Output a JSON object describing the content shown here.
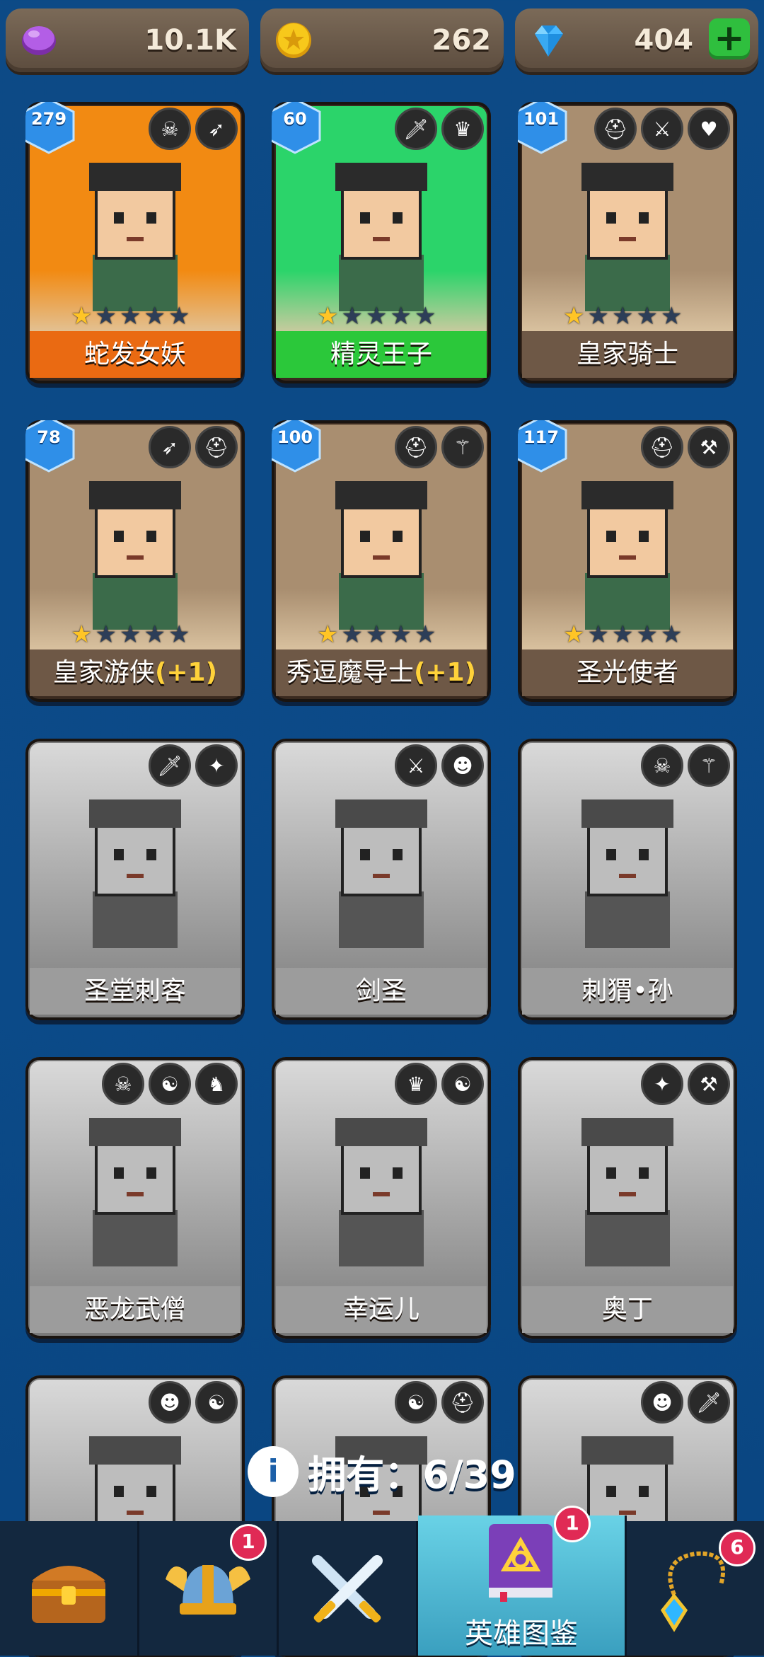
{
  "currencies": [
    {
      "name": "purple-gem",
      "value": "10.1K",
      "color": "#a34bd6"
    },
    {
      "name": "gold-coin",
      "value": "262",
      "color": "#f5c518"
    },
    {
      "name": "blue-diamond",
      "value": "404",
      "color": "#2fb7ff"
    }
  ],
  "heroes": [
    {
      "name": "蛇发女妖",
      "suffix": "",
      "level": "279",
      "stars": 1,
      "owned": true,
      "bg": "#f28a12",
      "bar": "#ea6a12",
      "badges": [
        "skull-icon",
        "bow-icon"
      ]
    },
    {
      "name": "精灵王子",
      "suffix": "",
      "level": "60",
      "stars": 1,
      "owned": true,
      "bg": "#2bd46a",
      "bar": "#2bc83a",
      "badges": [
        "dagger-icon",
        "elf-icon"
      ]
    },
    {
      "name": "皇家骑士",
      "suffix": "",
      "level": "101",
      "stars": 1,
      "owned": true,
      "bg": "#a98e70",
      "bar": "#6e5846",
      "badges": [
        "helmet-icon",
        "sword-icon",
        "heart-icon"
      ]
    },
    {
      "name": "皇家游侠",
      "suffix": "(+1)",
      "level": "78",
      "stars": 1,
      "owned": true,
      "bg": "#a98e70",
      "bar": "#6e5846",
      "badges": [
        "bow-icon",
        "helmet-icon"
      ]
    },
    {
      "name": "秀逗魔导士",
      "suffix": "(+1)",
      "level": "100",
      "stars": 1,
      "owned": true,
      "bg": "#a98e70",
      "bar": "#6e5846",
      "badges": [
        "helmet-icon",
        "staff-icon"
      ]
    },
    {
      "name": "圣光使者",
      "suffix": "",
      "level": "117",
      "stars": 1,
      "owned": true,
      "bg": "#a98e70",
      "bar": "#6e5846",
      "badges": [
        "helmet-icon",
        "hammer-icon"
      ]
    },
    {
      "name": "圣堂刺客",
      "suffix": "",
      "owned": false,
      "badges": [
        "dagger-icon",
        "wings-icon"
      ]
    },
    {
      "name": "剑圣",
      "suffix": "",
      "owned": false,
      "badges": [
        "sword-icon",
        "orc-icon"
      ]
    },
    {
      "name": "刺猬•孙",
      "suffix": "",
      "owned": false,
      "badges": [
        "skull-icon",
        "staff-icon"
      ]
    },
    {
      "name": "恶龙武僧",
      "suffix": "",
      "owned": false,
      "badges": [
        "skull-icon",
        "beast-icon",
        "dragon-icon"
      ]
    },
    {
      "name": "幸运儿",
      "suffix": "",
      "owned": false,
      "badges": [
        "elf-icon",
        "beast-icon"
      ]
    },
    {
      "name": "奥丁",
      "suffix": "",
      "owned": false,
      "badges": [
        "wings-icon",
        "hammer-icon"
      ]
    },
    {
      "name": "",
      "suffix": "",
      "owned": false,
      "badges": [
        "orc-icon",
        "beast-icon"
      ]
    },
    {
      "name": "",
      "suffix": "",
      "owned": false,
      "badges": [
        "beast-icon",
        "helmet-icon"
      ]
    },
    {
      "name": "",
      "suffix": "",
      "owned": false,
      "badges": [
        "orc-icon",
        "dagger-icon"
      ]
    }
  ],
  "summary": {
    "label": "拥有：",
    "count": "6/39"
  },
  "nav": {
    "tabs": [
      {
        "icon": "chest-icon",
        "label": "",
        "badge": ""
      },
      {
        "icon": "viking-helmet-icon",
        "label": "",
        "badge": "1"
      },
      {
        "icon": "crossed-swords-icon",
        "label": "",
        "badge": ""
      },
      {
        "icon": "hero-book-icon",
        "label": "英雄图鉴",
        "badge": "1",
        "active": true
      },
      {
        "icon": "amulet-icon",
        "label": "",
        "badge": "6"
      }
    ]
  }
}
